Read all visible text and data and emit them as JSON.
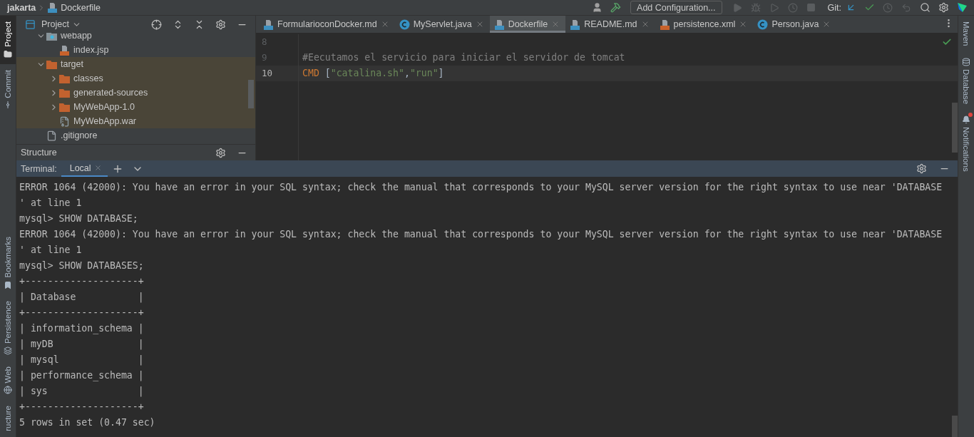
{
  "title_bar": {
    "project": "jakarta",
    "file": "Dockerfile"
  },
  "toolbar": {
    "run_config": "Add Configuration...",
    "git_label": "Git:"
  },
  "left_strip": {
    "top": [
      {
        "label": "Project",
        "kind": "folder",
        "selected": true
      },
      {
        "label": "Commit",
        "kind": "commit",
        "selected": false
      }
    ],
    "bottom": [
      {
        "label": "Bookmarks",
        "kind": "bookmark",
        "selected": false
      },
      {
        "label": "Persistence",
        "kind": "persistence",
        "selected": false
      },
      {
        "label": "Web",
        "kind": "globe",
        "selected": false
      },
      {
        "label": "ructure",
        "kind": "plain",
        "selected": false
      }
    ]
  },
  "project_panel": {
    "title": "Project",
    "tree": [
      {
        "label": "webapp",
        "kind": "webfolder",
        "expanded": true,
        "children": [
          {
            "label": "index.jsp",
            "kind": "jsp"
          }
        ]
      },
      {
        "label": "target",
        "kind": "folder",
        "expanded": true,
        "highlighted": true,
        "children": [
          {
            "label": "classes",
            "kind": "folder",
            "expanded": false
          },
          {
            "label": "generated-sources",
            "kind": "folder",
            "expanded": false
          },
          {
            "label": "MyWebApp-1.0",
            "kind": "folder",
            "expanded": false
          },
          {
            "label": "MyWebApp.war",
            "kind": "archive"
          }
        ]
      },
      {
        "label": ".gitignore",
        "kind": "ignore"
      }
    ]
  },
  "structure_panel": {
    "title": "Structure"
  },
  "editor": {
    "tabs": [
      {
        "label": "FormularioconDocker.md",
        "kind": "md",
        "selected": false
      },
      {
        "label": "MyServlet.java",
        "kind": "java",
        "selected": false
      },
      {
        "label": "Dockerfile",
        "kind": "docker",
        "selected": true
      },
      {
        "label": "README.md",
        "kind": "md",
        "selected": false
      },
      {
        "label": "persistence.xml",
        "kind": "xml",
        "selected": false
      },
      {
        "label": "Person.java",
        "kind": "java",
        "selected": false
      }
    ],
    "lines": [
      {
        "number": "8",
        "current": false
      },
      {
        "number": "9",
        "current": false,
        "tokens": [
          {
            "kind": "comment",
            "text": "#Eecutamos el servicio para iniciar el servidor de tomcat"
          }
        ]
      },
      {
        "number": "10",
        "current": true,
        "tokens": [
          {
            "kind": "keyword",
            "text": "CMD"
          },
          {
            "kind": "plain",
            "text": " ["
          },
          {
            "kind": "string",
            "text": "\"catalina.sh\""
          },
          {
            "kind": "plain",
            "text": ","
          },
          {
            "kind": "string",
            "text": "\"run\""
          },
          {
            "kind": "plain",
            "text": "]"
          }
        ]
      }
    ]
  },
  "terminal": {
    "title": "Terminal:",
    "tabs": [
      {
        "label": "Local",
        "selected": true
      }
    ],
    "lines": [
      "ERROR 1064 (42000): You have an error in your SQL syntax; check the manual that corresponds to your MySQL server version for the right syntax to use near 'DATABASE",
      "' at line 1",
      "mysql> SHOW DATABASE;",
      "ERROR 1064 (42000): You have an error in your SQL syntax; check the manual that corresponds to your MySQL server version for the right syntax to use near 'DATABASE",
      "' at line 1",
      "mysql> SHOW DATABASES;",
      "+--------------------+",
      "| Database           |",
      "+--------------------+",
      "| information_schema |",
      "| myDB               |",
      "| mysql              |",
      "| performance_schema |",
      "| sys                |",
      "+--------------------+",
      "5 rows in set (0.47 sec)"
    ]
  },
  "right_strip": [
    {
      "label": "Maven",
      "kind": "plain",
      "badge": false
    },
    {
      "label": "Database",
      "kind": "database",
      "badge": false
    },
    {
      "label": "Notifications",
      "kind": "bell",
      "badge": true
    }
  ]
}
